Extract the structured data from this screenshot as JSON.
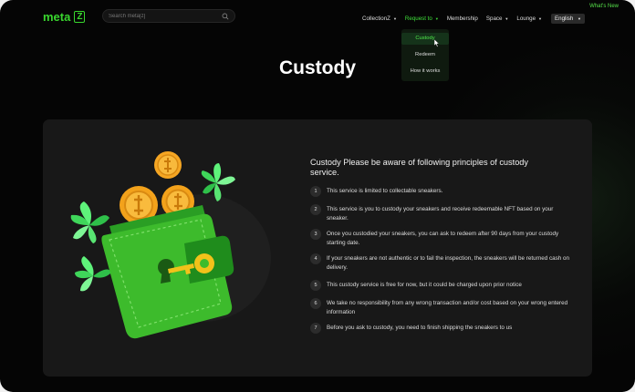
{
  "header": {
    "whats_new": "What's New",
    "logo_text": "meta",
    "logo_mark": "Z",
    "search_placeholder": "Search meta[z]"
  },
  "nav": {
    "items": [
      {
        "label": "CollectionZ",
        "caret": "▼"
      },
      {
        "label": "Request to",
        "caret": "▼"
      },
      {
        "label": "Membership"
      },
      {
        "label": "Space",
        "caret": "▼"
      },
      {
        "label": "Lounge",
        "caret": "▼"
      }
    ],
    "language": "English",
    "language_caret": "▼"
  },
  "dropdown": {
    "items": [
      {
        "label": "Custody",
        "active": true
      },
      {
        "label": "Redeem"
      },
      {
        "label": "How it works"
      }
    ]
  },
  "page": {
    "title": "Custody",
    "intro": "Custody Please be aware of following principles of custody service."
  },
  "rules": [
    {
      "num": "1",
      "text": "This service is limited to collectable sneakers."
    },
    {
      "num": "2",
      "text": "This service is you to custody your sneakers and receive redeemable NFT based on your sneaker."
    },
    {
      "num": "3",
      "text": "Once you custodied your sneakers, you can ask to redeem after 90 days from your custody starting date."
    },
    {
      "num": "4",
      "text": "If your sneakers are not authentic or to fail the inspection, the sneakers will be returned cash on delivery."
    },
    {
      "num": "5",
      "text": "This custody service is free for now, but it could be charged upon prior notice"
    },
    {
      "num": "6",
      "text": "We take no responsibility from any wrong transaction and/or cost based on your wrong entered information"
    },
    {
      "num": "7",
      "text": "Before you ask to custody, you need to finish shipping the sneakers to us"
    }
  ],
  "icons": {
    "search": "search-icon",
    "wallet": "wallet-illustration",
    "coin": "coin-icon",
    "key": "key-icon",
    "leaf": "leaf-icon",
    "cursor": "cursor-icon"
  },
  "colors": {
    "accent": "#39d62e",
    "background": "#050505",
    "panel": "#181818",
    "wallet_green": "#3dbb2c",
    "coin_gold": "#f3a21b"
  }
}
